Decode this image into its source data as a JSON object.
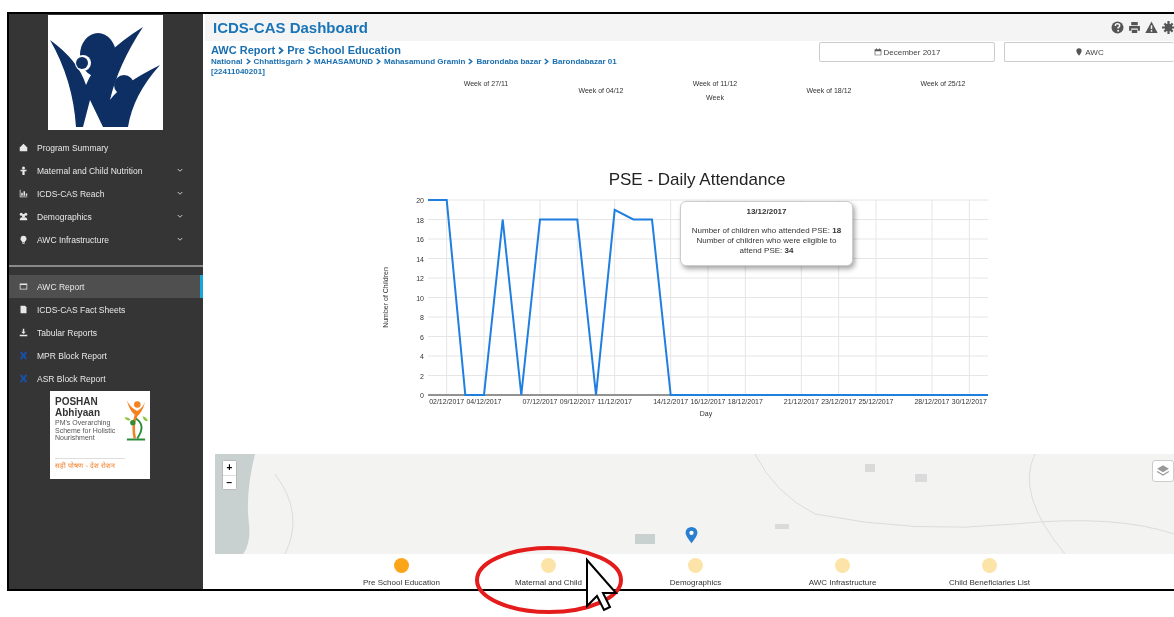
{
  "header": {
    "title": "ICDS-CAS Dashboard"
  },
  "sidebar": {
    "items": [
      {
        "label": "Program Summary",
        "expandable": false,
        "selected": false
      },
      {
        "label": "Maternal and Child Nutrition",
        "expandable": true,
        "selected": false
      },
      {
        "label": "ICDS-CAS Reach",
        "expandable": true,
        "selected": false
      },
      {
        "label": "Demographics",
        "expandable": true,
        "selected": false
      },
      {
        "label": "AWC Infrastructure",
        "expandable": true,
        "selected": false
      }
    ],
    "reports": [
      {
        "label": "AWC Report",
        "selected": true
      },
      {
        "label": "ICDS-CAS Fact Sheets",
        "selected": false
      },
      {
        "label": "Tabular Reports",
        "selected": false
      },
      {
        "label": "MPR Block Report",
        "selected": false
      },
      {
        "label": "ASR Block Report",
        "selected": false
      }
    ],
    "poshan_logo": {
      "name": "POSHAN",
      "name2": "Abhiyaan",
      "tagline": "PM's Overarching Scheme for Holistic Nourishment",
      "slogan": "सही पोषण - देश रोशन"
    }
  },
  "report": {
    "title": [
      "AWC Report",
      "Pre School Education"
    ],
    "breadcrumb": [
      "National",
      "Chhattisgarh",
      "MAHASAMUND",
      "Mahasamund Gramin",
      "Barondaba bazar",
      "Barondabazar 01"
    ],
    "code": "[22411040201]",
    "filters": [
      {
        "label": "December 2017"
      },
      {
        "label": "AWC"
      }
    ]
  },
  "weekly_chart": {
    "week_labels": [
      "Week of 27/11",
      "Week of 04/12",
      "Week of 11/12",
      "Week of 18/12",
      "Week of 25/12"
    ],
    "axis_title": "Week"
  },
  "daily_chart": {
    "chart_data": {
      "type": "line",
      "title": "PSE - Daily Attendance",
      "xlabel": "Day",
      "ylabel": "Number of Children",
      "categories": [
        null,
        "02/12/2017",
        null,
        "04/12/2017",
        null,
        null,
        "07/12/2017",
        null,
        "09/12/2017",
        null,
        "11/12/2017",
        null,
        null,
        "14/12/2017",
        null,
        "16/12/2017",
        null,
        "18/12/2017",
        null,
        null,
        "21/12/2017",
        null,
        "23/12/2017",
        null,
        "25/12/2017",
        null,
        null,
        "28/12/2017",
        null,
        "30/12/2017",
        null
      ],
      "values": [
        20,
        20,
        0,
        0,
        18,
        0,
        18,
        18,
        18,
        0,
        19,
        18,
        18,
        0,
        0,
        0,
        0,
        0,
        0,
        0,
        0,
        0,
        0,
        0,
        0,
        0,
        0,
        0,
        0,
        0,
        0
      ],
      "grid": true,
      "ylim": [
        0,
        20
      ],
      "yticks": [
        0,
        2,
        4,
        6,
        8,
        10,
        12,
        14,
        16,
        18,
        20
      ]
    },
    "tooltip": {
      "title": "13/12/2017",
      "text": "Number of children who attended PSE: **18**\nNumber of children who were eligible to attend PSE: **34**"
    }
  },
  "map": {
    "zoom_in": "+",
    "zoom_out": "−"
  },
  "legend": [
    {
      "label": "Pre School Education",
      "selected": true
    },
    {
      "label": "Maternal and Child",
      "selected": false
    },
    {
      "label": "Demographics",
      "selected": false
    },
    {
      "label": "AWC Infrastructure",
      "selected": false
    },
    {
      "label": "Child Beneficiaries List",
      "selected": false
    }
  ]
}
